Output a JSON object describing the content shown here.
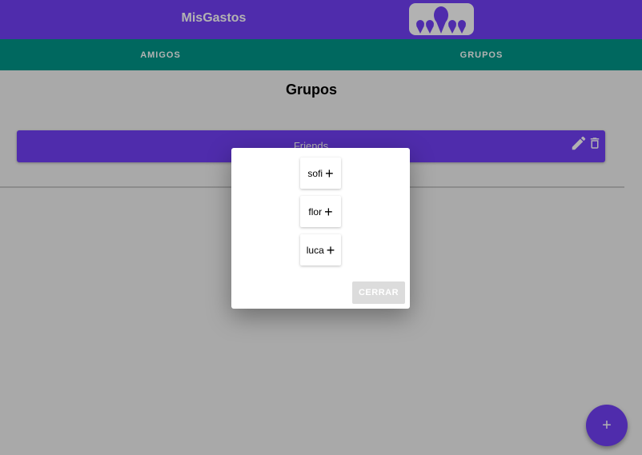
{
  "app": {
    "title": "MisGastos",
    "logo_icon": "people-group-icon"
  },
  "tabs": [
    {
      "label": "AMIGOS"
    },
    {
      "label": "GRUPOS"
    }
  ],
  "main": {
    "title": "Grupos",
    "groups": [
      {
        "name": "Friends",
        "edit_icon": "pencil-icon",
        "delete_icon": "trash-icon"
      }
    ]
  },
  "dialog": {
    "members": [
      {
        "name": "sofi",
        "action_icon": "plus-icon"
      },
      {
        "name": "flor",
        "action_icon": "plus-icon"
      },
      {
        "name": "luca",
        "action_icon": "plus-icon"
      }
    ],
    "close_label": "CERRAR"
  },
  "fab": {
    "label": "+",
    "icon": "plus-icon"
  },
  "colors": {
    "primary": "#7240f6",
    "secondary": "#009688",
    "background": "#f2f2f2",
    "disabled": "#dcdcdc"
  }
}
